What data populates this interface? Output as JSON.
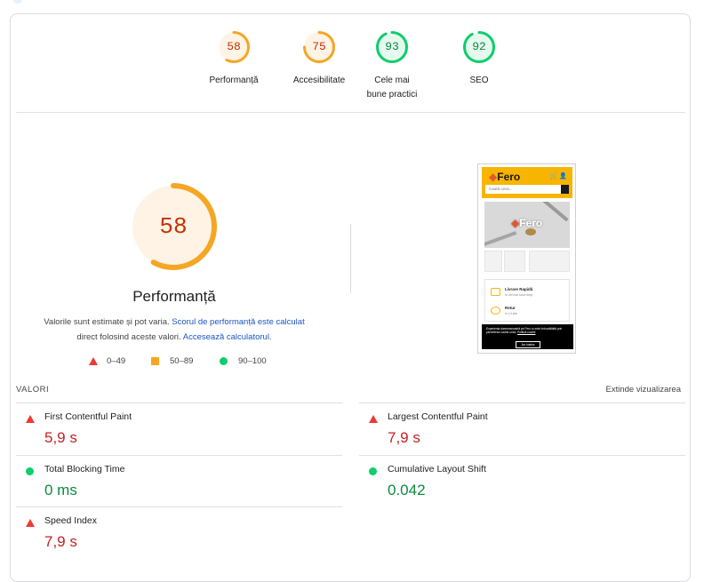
{
  "summary": [
    {
      "score": "58",
      "label": "Performanță",
      "value": 58,
      "status": "average"
    },
    {
      "score": "75",
      "label": "Accesibilitate",
      "value": 75,
      "status": "average"
    },
    {
      "score": "93",
      "label": "Cele mai bune practici",
      "value": 93,
      "status": "pass"
    },
    {
      "score": "92",
      "label": "SEO",
      "value": 92,
      "status": "pass"
    }
  ],
  "colors": {
    "pass": "#0cce6b",
    "average": "#f5a623",
    "fail": "#eb3a34",
    "average_text": "#c33300",
    "pass_text": "#0d8a3f"
  },
  "performance": {
    "score": "58",
    "value": 58,
    "title": "Performanță",
    "desc_text": "Valorile sunt estimate și pot varia. ",
    "desc_link1": "Scorul de performanță este calculat",
    "desc_text2": " direct folosind aceste valori. ",
    "desc_link2": "Accesează calculatorul."
  },
  "legend": [
    {
      "range": "0–49",
      "icon": "triangle-icon"
    },
    {
      "range": "50–89",
      "icon": "square-icon"
    },
    {
      "range": "90–100",
      "icon": "circle-icon"
    }
  ],
  "preview": {
    "logo": "Fero",
    "search_placeholder": "Caută ceva...",
    "card_items": [
      {
        "title": "Livrare Rapidă",
        "subtitle": "în cel mai scurt timp"
      },
      {
        "title": "Retur",
        "subtitle": "în 14 zile"
      }
    ],
    "cookie_text": "Experiența dumneavoastră pe Fero.ro este îmbunătățită prin permiterea cookie-urilor.",
    "cookie_link": "Politică cookie",
    "cookie_button": "Am înțeles"
  },
  "metrics": {
    "heading": "VALORI",
    "expand": "Extinde vizualizarea",
    "items": [
      {
        "name": "First Contentful Paint",
        "value": "5,9 s",
        "status": "fail"
      },
      {
        "name": "Largest Contentful Paint",
        "value": "7,9 s",
        "status": "fail"
      },
      {
        "name": "Total Blocking Time",
        "value": "0 ms",
        "status": "pass"
      },
      {
        "name": "Cumulative Layout Shift",
        "value": "0.042",
        "status": "pass"
      },
      {
        "name": "Speed Index",
        "value": "7,9 s",
        "status": "fail"
      }
    ]
  }
}
